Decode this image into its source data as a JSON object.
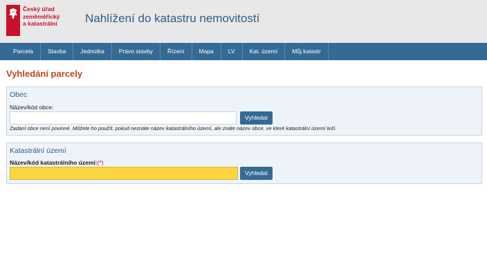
{
  "header": {
    "logo_lines": [
      "Český úřad",
      "zeměměřický",
      "a katastrální"
    ],
    "title": "Nahlížení do katastru nemovitostí"
  },
  "nav": {
    "items": [
      {
        "label": "Parcela"
      },
      {
        "label": "Stavba"
      },
      {
        "label": "Jednotka"
      },
      {
        "label": "Právo stavby"
      },
      {
        "label": "Řízení"
      },
      {
        "label": "Mapa"
      },
      {
        "label": "LV"
      },
      {
        "label": "Kat. území"
      },
      {
        "label": "Můj katastr"
      }
    ]
  },
  "page": {
    "heading": "Vyhledání parcely"
  },
  "obec": {
    "title": "Obec",
    "label": "Název/kód obce:",
    "value": "",
    "button": "Vyhledat",
    "hint": "Zadání obce není povinné. Můžete ho použít, pokud neznáte název katastrálního území, ale znáte název obce, ve které katastrální území leží."
  },
  "katastralni_uzemi": {
    "title": "Katastrální území",
    "label": "Název/kód katastrálního území:",
    "required_mark": "(*)",
    "value": "",
    "button": "Vyhledat"
  },
  "colors": {
    "header_bg": "#e8e8e8",
    "nav_bg": "#346a96",
    "brand_red": "#c8102e",
    "heading_orange": "#c0461c",
    "required_yellow": "#fbd542"
  }
}
